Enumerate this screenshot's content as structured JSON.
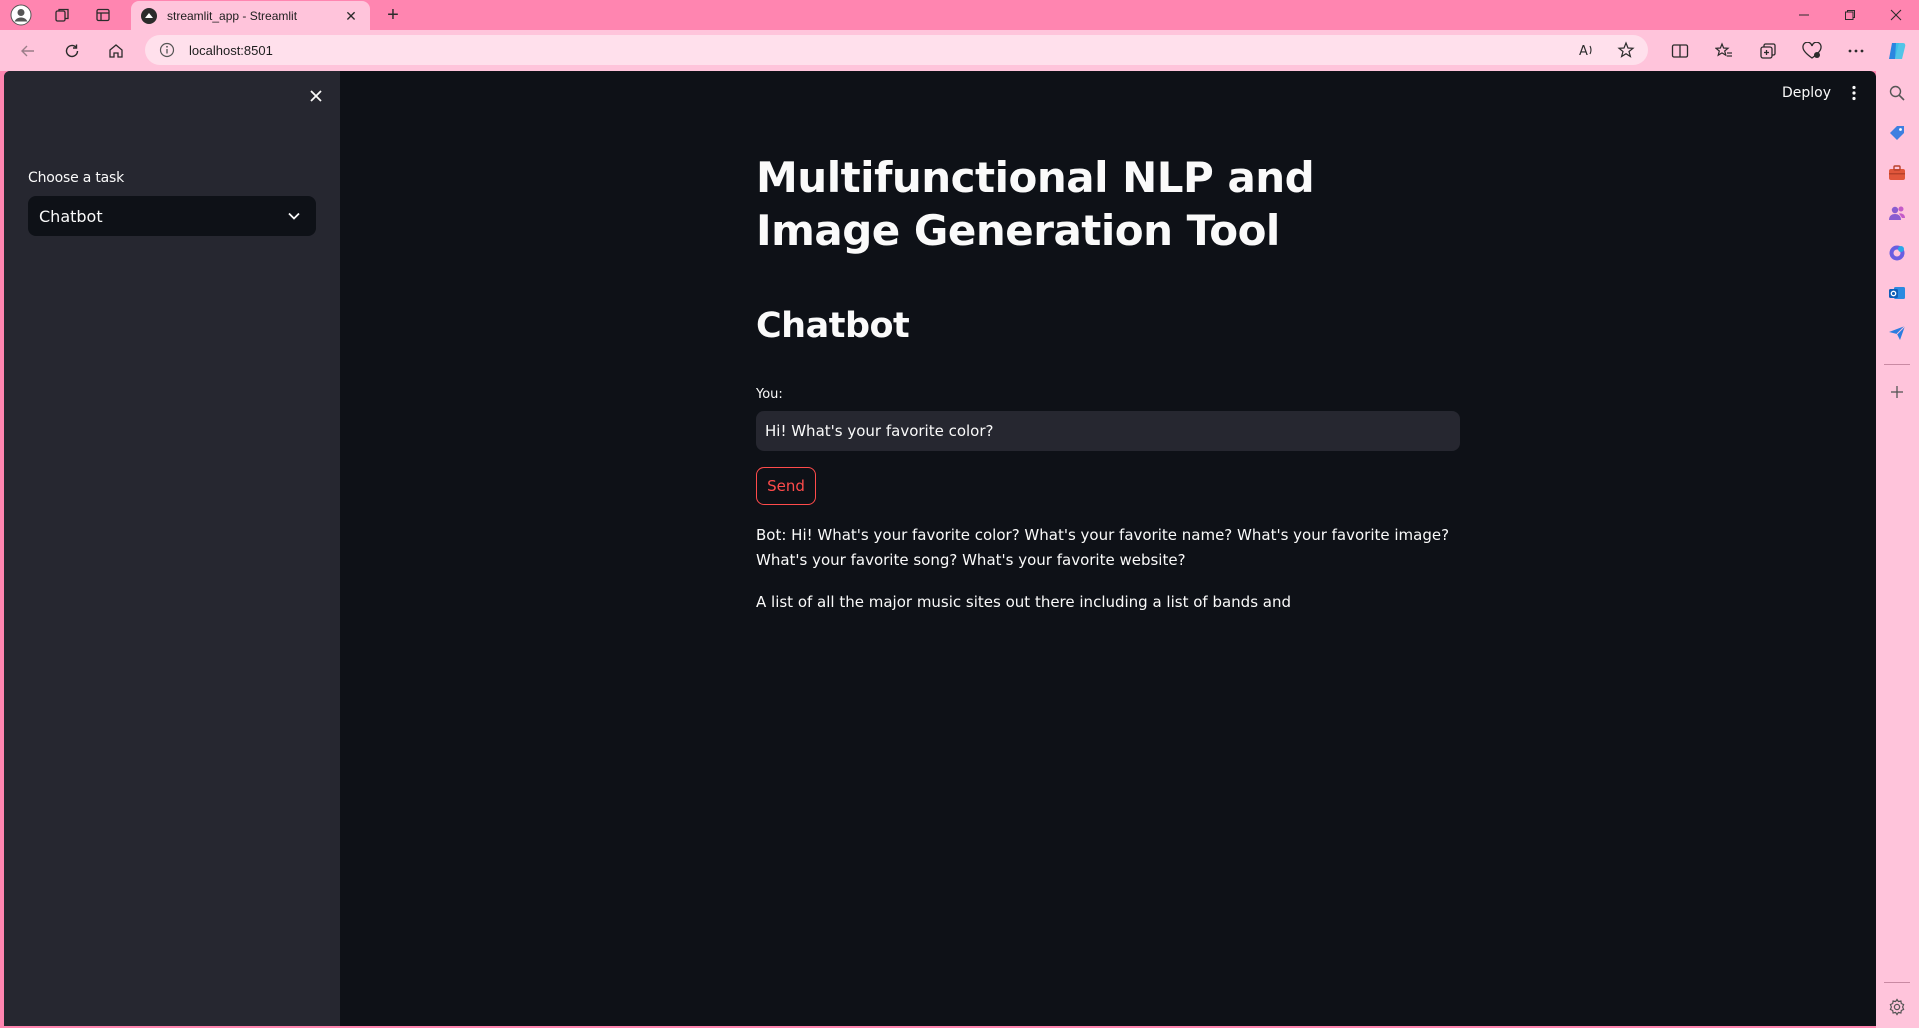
{
  "browser": {
    "tab_title": "streamlit_app - Streamlit",
    "url": "localhost:8501",
    "accent_color": "#ff85b0"
  },
  "app": {
    "sidebar": {
      "label": "Choose a task",
      "selected_task": "Chatbot"
    },
    "header": {
      "deploy_label": "Deploy"
    },
    "main": {
      "title": "Multifunctional NLP and Image Generation Tool",
      "section": "Chatbot",
      "input_label": "You:",
      "input_value": "Hi! What's your favorite color?",
      "send_label": "Send",
      "bot_response": "Bot: Hi! What's your favorite color? What's your favorite name? What's your favorite image? What's your favorite song? What's your favorite website?",
      "bot_response_2": "A list of all the major music sites out there including a list of bands and"
    },
    "colors": {
      "background": "#0e1117",
      "sidebar": "#262730",
      "primary": "#ff4b4b",
      "text": "#fafafa"
    }
  }
}
